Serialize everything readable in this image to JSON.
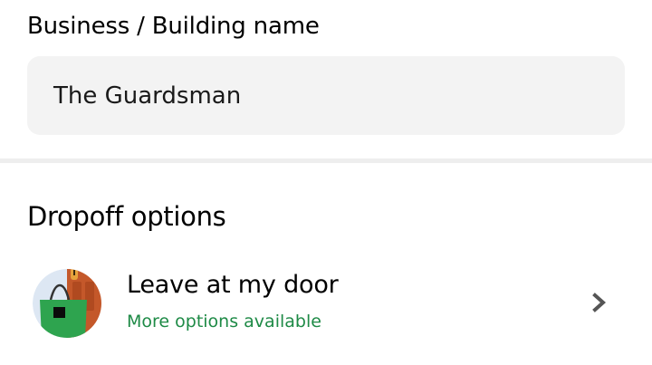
{
  "business_field": {
    "label": "Business / Building name",
    "value": "The Guardsman"
  },
  "dropoff": {
    "section_title": "Dropoff options",
    "option": {
      "title": "Leave at my door",
      "subtitle": "More options available",
      "icon": "door-bag-icon",
      "chevron_icon": "chevron-right-icon"
    }
  },
  "colors": {
    "accent_green": "#1e8a46",
    "input_bg": "#f3f3f3",
    "divider": "#eeeeee"
  }
}
